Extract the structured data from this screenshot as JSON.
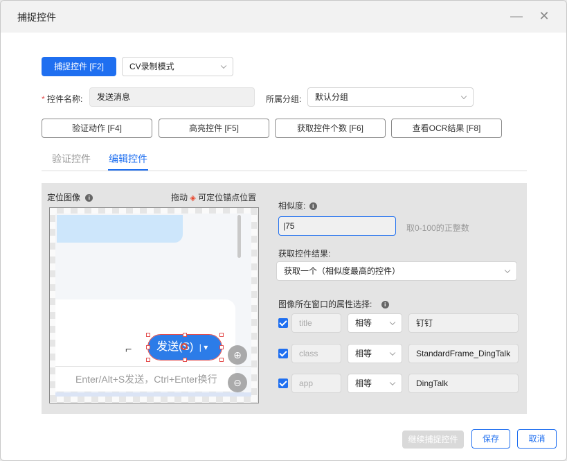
{
  "window": {
    "title": "捕捉控件"
  },
  "toolbar": {
    "capture_button": "捕捉控件 [F2]",
    "mode_select": "CV录制模式"
  },
  "form": {
    "required_mark": "*",
    "name_label": "控件名称:",
    "name_value": "发送消息",
    "group_label": "所属分组:",
    "group_value": "默认分组"
  },
  "actions": [
    {
      "label": "验证动作 [F4]"
    },
    {
      "label": "高亮控件 [F5]"
    },
    {
      "label": "获取控件个数 [F6]"
    },
    {
      "label": "查看OCR结果 [F8]"
    }
  ],
  "tabs": [
    {
      "label": "验证控件",
      "active": false
    },
    {
      "label": "编辑控件",
      "active": true
    }
  ],
  "locate": {
    "title": "定位图像",
    "hint_prefix": "拖动",
    "hint_suffix": "可定位锚点位置",
    "send_button": "发送(S)",
    "input_hint": "Enter/Alt+S发送，Ctrl+Enter换行"
  },
  "similarity": {
    "label": "相似度:",
    "value": "75",
    "hint": "取0-100的正整数"
  },
  "result": {
    "label": "获取控件结果:",
    "value": "获取一个（相似度最高的控件）"
  },
  "attributes": {
    "label": "图像所在窗口的属性选择:",
    "rows": [
      {
        "name": "title",
        "op": "相等",
        "value": "钉钉",
        "checked": true
      },
      {
        "name": "class",
        "op": "相等",
        "value": "StandardFrame_DingTalk",
        "checked": true
      },
      {
        "name": "app",
        "op": "相等",
        "value": "DingTalk",
        "checked": true
      }
    ]
  },
  "footer": {
    "continue": "继续捕捉控件",
    "save": "保存",
    "cancel": "取消"
  },
  "colors": {
    "accent": "#1f6ff0",
    "required": "#e34d4d",
    "anchor": "#e8452b"
  }
}
